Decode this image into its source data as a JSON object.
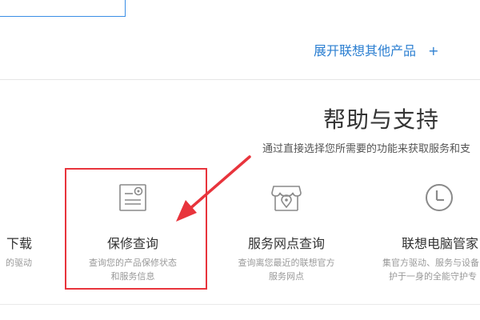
{
  "header": {
    "expand_link_label": "展开联想其他产品",
    "expand_link_plus": "+"
  },
  "support": {
    "title": "帮助与支持",
    "subtitle": "通过直接选择您所需要的功能来获取服务和支",
    "cards": [
      {
        "icon": "download-icon",
        "title": "下载",
        "desc_line1": "的驱动",
        "desc_line2": ""
      },
      {
        "icon": "warranty-document-gear-icon",
        "title": "保修查询",
        "desc_line1": "查询您的产品保修状态",
        "desc_line2": "和服务信息"
      },
      {
        "icon": "store-location-icon",
        "title": "服务网点查询",
        "desc_line1": "查询离您最近的联想官方",
        "desc_line2": "服务网点"
      },
      {
        "icon": "clock-icon",
        "title": "联想电脑管家",
        "desc_line1": "集官方驱动、服务与设备",
        "desc_line2": "护于一身的全能守护专"
      }
    ]
  },
  "annotation": {
    "highlight_color": "#e8343c",
    "arrow_color": "#e8343c"
  }
}
